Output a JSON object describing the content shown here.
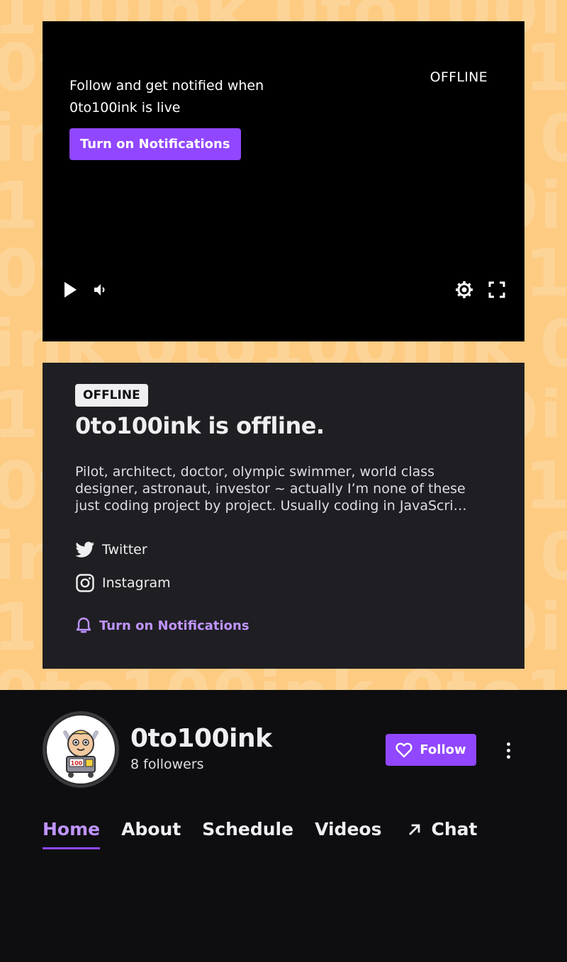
{
  "player": {
    "message": "Follow and get notified when 0to100ink is live",
    "status": "OFFLINE",
    "notify_button": "Turn on Notifications"
  },
  "card": {
    "badge": "OFFLINE",
    "title": "0to100ink is offline.",
    "description": "Pilot, architect, doctor, olympic swimmer, world class designer, astronaut, investor ~ actually I’m none of these just coding project by project. Usually coding in JavaScri…",
    "socials": [
      {
        "label": "Twitter",
        "icon": "twitter-icon"
      },
      {
        "label": "Instagram",
        "icon": "instagram-icon"
      }
    ],
    "notify_link": "Turn on Notifications"
  },
  "channel": {
    "name": "0to100ink",
    "followers": "8 followers",
    "follow_button": "Follow"
  },
  "tabs": [
    {
      "label": "Home",
      "active": true
    },
    {
      "label": "About"
    },
    {
      "label": "Schedule"
    },
    {
      "label": "Videos"
    },
    {
      "label": "Chat",
      "icon": "external-arrow-icon"
    }
  ],
  "colors": {
    "accent": "#9147ff",
    "accent_light": "#bf94ff",
    "banner": "#fdcb82",
    "background": "#0e0e10",
    "card": "#1f1f23"
  }
}
